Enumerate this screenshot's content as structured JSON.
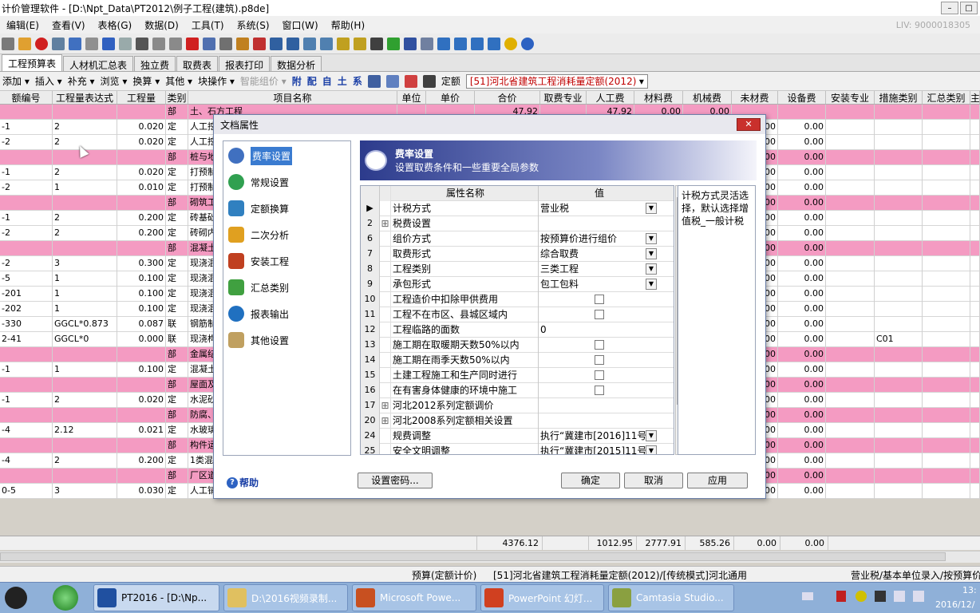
{
  "window": {
    "title": "计价管理软件 - [D:\\Npt_Data\\PT2012\\例子工程(建筑).p8de]"
  },
  "menu": [
    "编辑(E)",
    "查看(V)",
    "表格(G)",
    "数据(D)",
    "工具(T)",
    "系统(S)",
    "窗口(W)",
    "帮助(H)"
  ],
  "license": "LIV: 9000018305",
  "tabs": [
    "工程预算表",
    "人材机汇总表",
    "独立费",
    "取费表",
    "报表打印",
    "数据分析"
  ],
  "toolbar2": {
    "items": [
      "添加 ▾",
      "插入 ▾",
      "补充 ▾",
      "浏览 ▾",
      "换算 ▾",
      "其他 ▾",
      "块操作 ▾",
      "智能组价 ▾"
    ],
    "chars": [
      "附",
      "配",
      "自",
      "土",
      "系"
    ],
    "quota_label": "定额",
    "quota_value": "[51]河北省建筑工程消耗量定额(2012)"
  },
  "grid": {
    "headers": [
      "额编号",
      "工程量表达式",
      "工程量",
      "类别",
      "项目名称",
      "单位",
      "单价",
      "合价",
      "取费专业",
      "人工费",
      "材料费",
      "机械费",
      "未材费",
      "设备费",
      "安装专业",
      "措施类别",
      "汇总类别",
      "主"
    ],
    "rows": [
      {
        "c0": "",
        "c1": "",
        "c2": "",
        "c3": "部",
        "c4": "土、石方工程",
        "c5": "",
        "c6": "",
        "c7": "47.92",
        "c8": "",
        "c9": "47.92",
        "c10": "0.00",
        "c11": "0.00",
        "c12": "",
        "c13": "",
        "c14": "",
        "c15": "",
        "c16": "",
        "pink": true
      },
      {
        "c0": "-1",
        "c1": "2",
        "c2": "0.020",
        "c3": "定",
        "c4": "人工挖",
        "c12": "00",
        "c13": "0.00"
      },
      {
        "c0": "-2",
        "c1": "2",
        "c2": "0.020",
        "c3": "定",
        "c4": "人工挖",
        "c12": "00",
        "c13": "0.00"
      },
      {
        "c0": "",
        "c1": "",
        "c2": "",
        "c3": "部",
        "c4": "桩与地",
        "c12": "00",
        "c13": "0.00",
        "pink": true
      },
      {
        "c0": "-1",
        "c1": "2",
        "c2": "0.020",
        "c3": "定",
        "c4": "打预制",
        "c12": "00",
        "c13": "0.00"
      },
      {
        "c0": "-2",
        "c1": "1",
        "c2": "0.010",
        "c3": "定",
        "c4": "打预制",
        "c12": "00",
        "c13": "0.00"
      },
      {
        "c0": "",
        "c1": "",
        "c2": "",
        "c3": "部",
        "c4": "砌筑工",
        "c12": "00",
        "c13": "0.00",
        "pink": true
      },
      {
        "c0": "-1",
        "c1": "2",
        "c2": "0.200",
        "c3": "定",
        "c4": "砖基础",
        "c12": "00",
        "c13": "0.00"
      },
      {
        "c0": "-2",
        "c1": "2",
        "c2": "0.200",
        "c3": "定",
        "c4": "砖砌内",
        "c12": "00",
        "c13": "0.00"
      },
      {
        "c0": "",
        "c1": "",
        "c2": "",
        "c3": "部",
        "c4": "混凝土",
        "c12": "00",
        "c13": "0.00",
        "pink": true
      },
      {
        "c0": "-2",
        "c1": "3",
        "c2": "0.300",
        "c3": "定",
        "c4": "现浇混",
        "c12": "00",
        "c13": "0.00"
      },
      {
        "c0": "-5",
        "c1": "1",
        "c2": "0.100",
        "c3": "定",
        "c4": "现浇混",
        "c12": "00",
        "c13": "0.00"
      },
      {
        "c0": "-201",
        "c1": "1",
        "c2": "0.100",
        "c3": "定",
        "c4": "现浇混",
        "c12": "00",
        "c13": "0.00"
      },
      {
        "c0": "-202",
        "c1": "1",
        "c2": "0.100",
        "c3": "定",
        "c4": "现浇混",
        "c12": "00",
        "c13": "0.00"
      },
      {
        "c0": "-330",
        "c1": "GGCL*0.873",
        "c2": "0.087",
        "c3": "联",
        "c4": "钢筋制",
        "c12": "00",
        "c13": "0.00"
      },
      {
        "c0": "2-41",
        "c1": "GGCL*0",
        "c2": "0.000",
        "c3": "联",
        "c4": "现浇构",
        "c12": "00",
        "c13": "0.00",
        "c15": "C01"
      },
      {
        "c0": "",
        "c1": "",
        "c2": "",
        "c3": "部",
        "c4": "金属结",
        "c12": "00",
        "c13": "0.00",
        "pink": true
      },
      {
        "c0": "-1",
        "c1": "1",
        "c2": "0.100",
        "c3": "定",
        "c4": "混凝土",
        "c12": "00",
        "c13": "0.00"
      },
      {
        "c0": "",
        "c1": "",
        "c2": "",
        "c3": "部",
        "c4": "屋面及",
        "c12": "00",
        "c13": "0.00",
        "pink": true
      },
      {
        "c0": "-1",
        "c1": "2",
        "c2": "0.020",
        "c3": "定",
        "c4": "水泥砂",
        "c12": "00",
        "c13": "0.00"
      },
      {
        "c0": "",
        "c1": "",
        "c2": "",
        "c3": "部",
        "c4": "防腐、",
        "c12": "00",
        "c13": "0.00",
        "pink": true
      },
      {
        "c0": "-4",
        "c1": "2.12",
        "c2": "0.021",
        "c3": "定",
        "c4": "水玻璃",
        "c12": "00",
        "c13": "0.00"
      },
      {
        "c0": "",
        "c1": "",
        "c2": "",
        "c3": "部",
        "c4": "构件运",
        "c12": "00",
        "c13": "0.00",
        "pink": true
      },
      {
        "c0": "-4",
        "c1": "2",
        "c2": "0.200",
        "c3": "定",
        "c4": "1类混",
        "c12": "00",
        "c13": "0.00"
      },
      {
        "c0": "",
        "c1": "",
        "c2": "",
        "c3": "部",
        "c4": "厂区道",
        "c12": "00",
        "c13": "0.00",
        "pink": true
      },
      {
        "c0": "0-5",
        "c1": "3",
        "c2": "0.030",
        "c3": "定",
        "c4": "人工铺",
        "c12": "00",
        "c13": "0.00"
      }
    ]
  },
  "totals": {
    "c7": "4376.12",
    "c9": "1012.95",
    "c10": "2777.91",
    "c11": "585.26",
    "c12": "0.00",
    "c13": "0.00"
  },
  "status": {
    "left": "预算(定额计价)",
    "middle": "[51]河北省建筑工程消耗量定额(2012)/[传统模式]河北通用",
    "right": "营业税/基本单位录入/按预算价"
  },
  "dialog": {
    "title": "文档属性",
    "nav": [
      "费率设置",
      "常规设置",
      "定额换算",
      "二次分析",
      "安装工程",
      "汇总类别",
      "报表输出",
      "其他设置"
    ],
    "header_title": "费率设置",
    "header_sub": "设置取费条件和一些重要全局参数",
    "col_name": "属性名称",
    "col_value": "值",
    "props": [
      {
        "no": "",
        "ex": "",
        "name": "计税方式",
        "value": "营业税",
        "type": "dd",
        "current": true
      },
      {
        "no": "2",
        "ex": "⊞",
        "name": "税费设置",
        "value": "",
        "type": "none"
      },
      {
        "no": "6",
        "ex": "",
        "name": "组价方式",
        "value": "按预算价进行组价",
        "type": "dd"
      },
      {
        "no": "7",
        "ex": "",
        "name": "取费形式",
        "value": "综合取费",
        "type": "dd"
      },
      {
        "no": "8",
        "ex": "",
        "name": "工程类别",
        "value": "三类工程",
        "type": "dd"
      },
      {
        "no": "9",
        "ex": "",
        "name": "承包形式",
        "value": "包工包料",
        "type": "dd"
      },
      {
        "no": "10",
        "ex": "",
        "name": "工程造价中扣除甲供费用",
        "value": "",
        "type": "cb"
      },
      {
        "no": "11",
        "ex": "",
        "name": "工程不在市区、县城区域内",
        "value": "",
        "type": "cb"
      },
      {
        "no": "12",
        "ex": "",
        "name": "工程临路的面数",
        "value": "0",
        "type": "none"
      },
      {
        "no": "13",
        "ex": "",
        "name": "施工期在取暖期天数50%以内",
        "value": "",
        "type": "cb"
      },
      {
        "no": "14",
        "ex": "",
        "name": "施工期在雨季天数50%以内",
        "value": "",
        "type": "cb"
      },
      {
        "no": "15",
        "ex": "",
        "name": "土建工程施工和生产同时进行",
        "value": "",
        "type": "cb"
      },
      {
        "no": "16",
        "ex": "",
        "name": "在有害身体健康的环境中施工",
        "value": "",
        "type": "cb"
      },
      {
        "no": "17",
        "ex": "⊞",
        "name": "河北2012系列定额调价",
        "value": "",
        "type": "none"
      },
      {
        "no": "20",
        "ex": "⊞",
        "name": "河北2008系列定额相关设置",
        "value": "",
        "type": "none"
      },
      {
        "no": "24",
        "ex": "",
        "name": "规费调整",
        "value": "执行“冀建市[2016]11号",
        "type": "dd"
      },
      {
        "no": "25",
        "ex": "",
        "name": "安全文明调整",
        "value": "执行“冀建市[2015]11号",
        "type": "dd"
      }
    ],
    "description": "计税方式灵活选择，默认选择增值税_一般计税",
    "help": "帮助",
    "btn_password": "设置密码...",
    "btn_ok": "确定",
    "btn_cancel": "取消",
    "btn_apply": "应用"
  },
  "taskbar": {
    "items": [
      "PT2016 - [D:\\Np...",
      "D:\\2016视频录制...",
      "Microsoft Powe...",
      "PowerPoint 幻灯...",
      "Camtasia Studio..."
    ],
    "clock_time": "13:",
    "clock_date": "2016/12/"
  }
}
